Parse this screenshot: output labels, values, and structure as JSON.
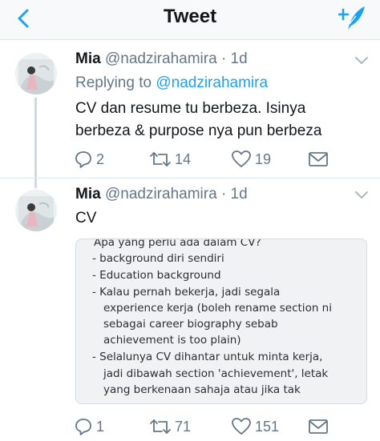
{
  "nav": {
    "title": "Tweet",
    "back_icon": "chevron-left-icon",
    "compose_icon": "compose-tweet-icon",
    "accent": "#1da1f2"
  },
  "tweets": [
    {
      "name": "Mia",
      "handle": "@nadzirahamira",
      "time": "· 1d",
      "replying_prefix": "Replying to",
      "replying_handle": "@nadzirahamira",
      "text_line1": "CV dan resume tu berbeza. Isinya",
      "text_line2": "berbeza & purpose nya pun berbeza",
      "replies": "2",
      "retweets": "14",
      "likes": "19"
    },
    {
      "name": "Mia",
      "handle": "@nadzirahamira",
      "time": "· 1d",
      "text": "CV",
      "replies": "1",
      "retweets": "71",
      "likes": "151",
      "attachment": {
        "lines": [
          "Apa yang perlu ada dalam CV?",
          "- background diri sendiri",
          "- Education background",
          "- Kalau pernah bekerja, jadi segala",
          "experience kerja (boleh rename section ni",
          "sebagai career biography sebab",
          "achievement is too plain)",
          "- Selalunya CV dihantar untuk minta kerja,",
          "jadi dibawah section 'achievement', letak",
          "yang berkenaan sahaja atau jika tak"
        ]
      }
    }
  ],
  "colors": {
    "text": "#14171a",
    "muted": "#657786",
    "link": "#1da1f2",
    "divider": "#e1e8ed"
  }
}
